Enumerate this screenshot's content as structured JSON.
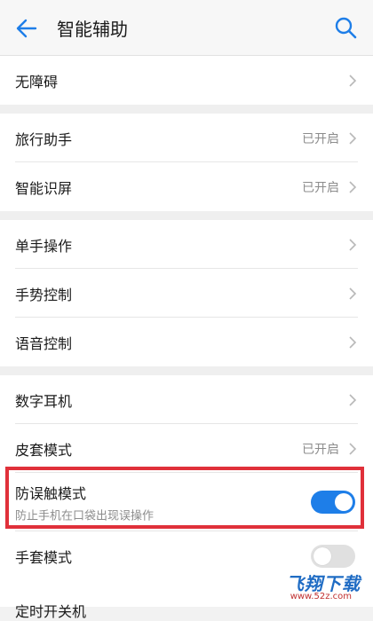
{
  "header": {
    "title": "智能辅助"
  },
  "sections": [
    {
      "rows": [
        {
          "label": "无障碍",
          "status": ""
        }
      ]
    },
    {
      "rows": [
        {
          "label": "旅行助手",
          "status": "已开启"
        },
        {
          "label": "智能识屏",
          "status": "已开启"
        }
      ]
    },
    {
      "rows": [
        {
          "label": "单手操作",
          "status": ""
        },
        {
          "label": "手势控制",
          "status": ""
        },
        {
          "label": "语音控制",
          "status": ""
        }
      ]
    },
    {
      "rows": [
        {
          "label": "数字耳机",
          "status": ""
        },
        {
          "label": "皮套模式",
          "status": "已开启"
        }
      ]
    }
  ],
  "toggles": {
    "pocket_mode": {
      "label": "防误触模式",
      "sub": "防止手机在口袋出现误操作",
      "on": true
    },
    "glove_mode": {
      "label": "手套模式",
      "on": false
    }
  },
  "partial_row": {
    "label": "定时开关机"
  },
  "watermark": {
    "main": "飞翔下载",
    "sub": "www.52z.com"
  },
  "colors": {
    "accent": "#1e7ee8",
    "highlight": "#e0303a"
  }
}
